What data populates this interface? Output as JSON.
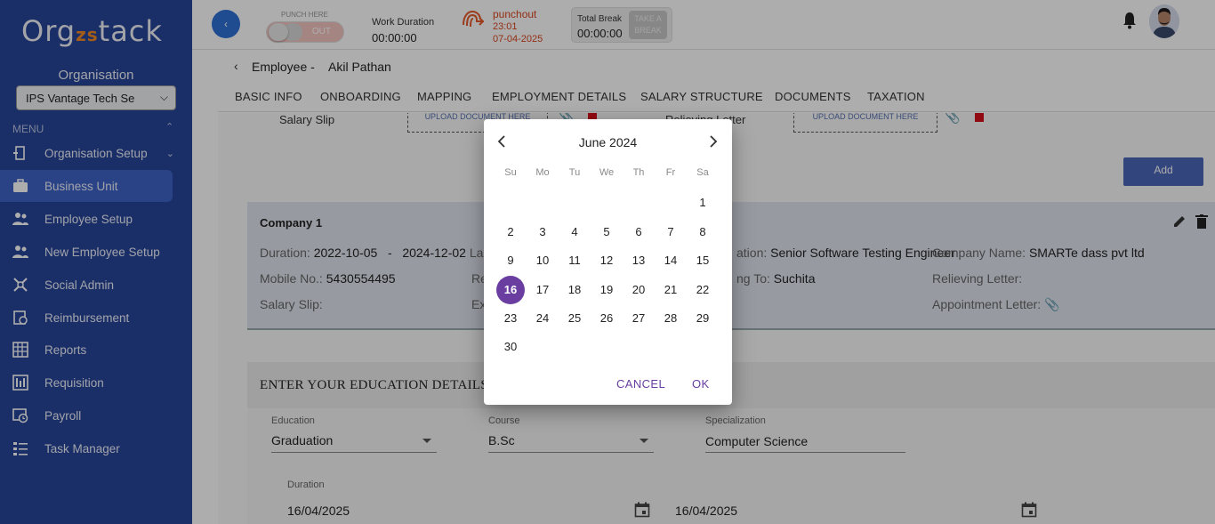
{
  "brand": {
    "logo_pre": "Org",
    "logo_mid": "zs",
    "logo_post": "tack"
  },
  "sidebar": {
    "org_label": "Organisation",
    "org_value": "IPS Vantage Tech Se",
    "menu_label": "MENU",
    "items": [
      {
        "label": "Organisation Setup",
        "icon": "org-setup-icon"
      },
      {
        "label": "Business Unit",
        "icon": "briefcase-icon"
      },
      {
        "label": "Employee Setup",
        "icon": "people-icon"
      },
      {
        "label": "New Employee Setup",
        "icon": "people-icon"
      },
      {
        "label": "Social Admin",
        "icon": "social-icon"
      },
      {
        "label": "Reimbursement",
        "icon": "reimbursement-icon"
      },
      {
        "label": "Reports",
        "icon": "reports-icon"
      },
      {
        "label": "Requisition",
        "icon": "requisition-icon"
      },
      {
        "label": "Payroll",
        "icon": "payroll-icon"
      },
      {
        "label": "Task Manager",
        "icon": "task-icon"
      }
    ],
    "active_index": 1
  },
  "topbar": {
    "punch_label": "PUNCH HERE",
    "punch_state": "OUT",
    "work_duration_label": "Work Duration",
    "work_duration": "00:00:00",
    "punchout_label": "punchout",
    "punchout_time": "23:01",
    "punchout_date": "07-04-2025",
    "break_label": "Total Break",
    "break_value": "00:00:00",
    "take_break_1": "TAKE A",
    "take_break_2": "BREAK"
  },
  "employee": {
    "prefix": "Employee -",
    "name": "Akil Pathan"
  },
  "tabs": [
    "BASIC INFO",
    "ONBOARDING",
    "MAPPING",
    "EMPLOYMENT DETAILS",
    "SALARY STRUCTURE",
    "DOCUMENTS",
    "TAXATION"
  ],
  "documents": {
    "salary_slip_label": "Salary Slip",
    "relieving_label": "Relieving Letter",
    "upload_text": "UPLOAD DOCUMENT HERE",
    "add_label": "Add"
  },
  "company": {
    "title": "Company 1",
    "duration_label": "Duration:",
    "duration_value": "2022-10-05   -   2024-12-02",
    "duration_suffix": "La",
    "mobile_label": "Mobile No.:",
    "mobile_value": "5430554495",
    "mobile_suffix": "Re",
    "salary_slip_label": "Salary Slip:",
    "salary_suffix": "Ex",
    "designation_partial": "ation:",
    "designation_value": "Senior Software Testing Engineer",
    "company_name_label": "Company Name:",
    "company_name_value": "SMARTe dass pvt ltd",
    "reporting_partial": "ng To:",
    "reporting_value": "Suchita",
    "relieving_label": "Relieving Letter:",
    "appointment_label": "Appointment Letter:"
  },
  "education": {
    "title": "ENTER YOUR EDUCATION DETAILS",
    "education_label": "Education",
    "education_value": "Graduation",
    "course_label": "Course",
    "course_value": "B.Sc",
    "specialization_label": "Specialization",
    "specialization_value": "Computer Science",
    "duration_label": "Duration",
    "from_date": "16/04/2025",
    "to_date": "16/04/2025"
  },
  "datepicker": {
    "month_title": "June 2024",
    "weekdays": [
      "Su",
      "Mo",
      "Tu",
      "We",
      "Th",
      "Fr",
      "Sa"
    ],
    "first_weekday_index": 6,
    "days_in_month": 30,
    "selected_day": 16,
    "cancel_label": "CANCEL",
    "ok_label": "OK",
    "accent_color": "#6a3ea1"
  }
}
